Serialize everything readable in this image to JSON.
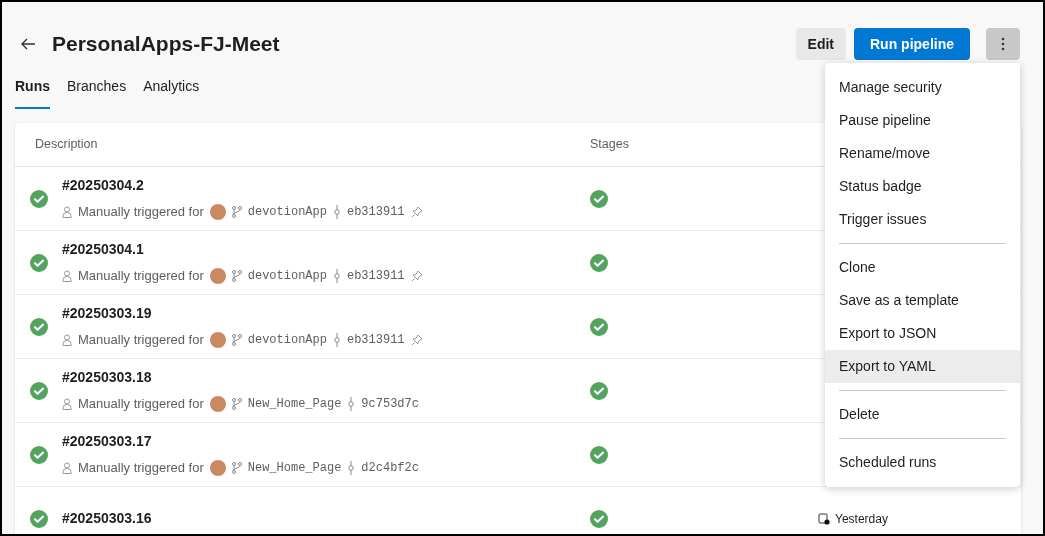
{
  "header": {
    "title": "PersonalApps-FJ-Meet",
    "buttons": [
      {
        "label": "Edit",
        "kind": "secondary"
      },
      {
        "label": "Run pipeline",
        "kind": "primary"
      }
    ]
  },
  "tabs": [
    {
      "label": "Runs",
      "selected": true
    },
    {
      "label": "Branches",
      "selected": false
    },
    {
      "label": "Analytics",
      "selected": false
    }
  ],
  "table": {
    "columns": [
      "Description",
      "Stages"
    ],
    "rows": [
      {
        "title": "#20250304.2",
        "trigger": "Manually triggered for",
        "branch": "devotionApp",
        "commit": "eb313911",
        "pinned": true,
        "stage_succeeded": true
      },
      {
        "title": "#20250304.1",
        "trigger": "Manually triggered for",
        "branch": "devotionApp",
        "commit": "eb313911",
        "pinned": true,
        "stage_succeeded": true
      },
      {
        "title": "#20250303.19",
        "trigger": "Manually triggered for",
        "branch": "devotionApp",
        "commit": "eb313911",
        "pinned": true,
        "stage_succeeded": true
      },
      {
        "title": "#20250303.18",
        "trigger": "Manually triggered for",
        "branch": "New_Home_Page",
        "commit": "9c753d7c",
        "pinned": false,
        "stage_succeeded": true
      },
      {
        "title": "#20250303.17",
        "trigger": "Manually triggered for",
        "branch": "New_Home_Page",
        "commit": "d2c4bf2c",
        "pinned": false,
        "stage_succeeded": true
      },
      {
        "title": "#20250303.16",
        "stage_succeeded": true,
        "when": "Yesterday"
      }
    ]
  },
  "menu": {
    "items": [
      {
        "kind": "item",
        "label": "Manage security",
        "highlighted": false
      },
      {
        "kind": "item",
        "label": "Pause pipeline",
        "highlighted": false
      },
      {
        "kind": "item",
        "label": "Rename/move",
        "highlighted": false
      },
      {
        "kind": "item",
        "label": "Status badge",
        "highlighted": false
      },
      {
        "kind": "item",
        "label": "Trigger issues",
        "highlighted": false
      },
      {
        "kind": "separator"
      },
      {
        "kind": "item",
        "label": "Clone",
        "highlighted": false
      },
      {
        "kind": "item",
        "label": "Save as a template",
        "highlighted": false
      },
      {
        "kind": "item",
        "label": "Export to JSON",
        "highlighted": false
      },
      {
        "kind": "item",
        "label": "Export to YAML",
        "highlighted": true
      },
      {
        "kind": "separator"
      },
      {
        "kind": "item",
        "label": "Delete",
        "highlighted": false
      },
      {
        "kind": "separator"
      },
      {
        "kind": "item",
        "label": "Scheduled runs",
        "highlighted": false
      }
    ]
  }
}
